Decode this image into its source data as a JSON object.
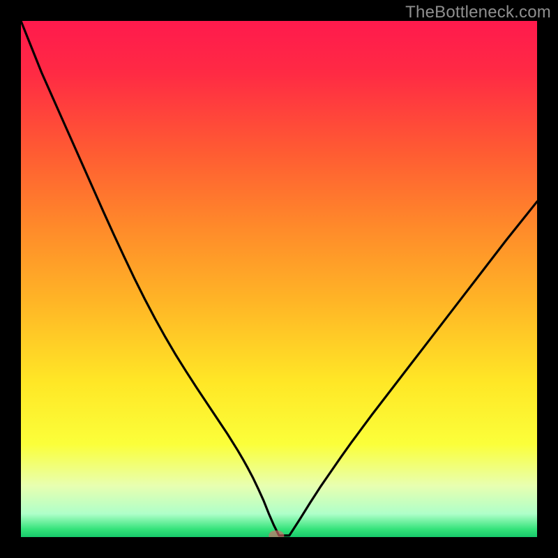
{
  "watermark": "TheBottleneck.com",
  "colors": {
    "frame": "#000000",
    "watermark": "#8f8f8f",
    "curve": "#000000",
    "gradient_stops": [
      {
        "offset": 0.0,
        "color": "#ff1a4d"
      },
      {
        "offset": 0.1,
        "color": "#ff2a44"
      },
      {
        "offset": 0.25,
        "color": "#ff5a33"
      },
      {
        "offset": 0.4,
        "color": "#ff8a2a"
      },
      {
        "offset": 0.55,
        "color": "#ffb726"
      },
      {
        "offset": 0.7,
        "color": "#ffe726"
      },
      {
        "offset": 0.82,
        "color": "#fbff3a"
      },
      {
        "offset": 0.9,
        "color": "#e8ffb0"
      },
      {
        "offset": 0.955,
        "color": "#afffc9"
      },
      {
        "offset": 0.985,
        "color": "#34e37a"
      },
      {
        "offset": 1.0,
        "color": "#17c96b"
      }
    ],
    "marker_fill": "#d86a6a",
    "marker_opacity": 0.65
  },
  "chart_data": {
    "type": "line",
    "title": "",
    "xlabel": "",
    "ylabel": "",
    "xlim": [
      0,
      100
    ],
    "ylim": [
      0,
      100
    ],
    "grid": false,
    "x": [
      0,
      2,
      4,
      6,
      8,
      10,
      12,
      14,
      16,
      18,
      20,
      22,
      24,
      26,
      28,
      30,
      32,
      34,
      36,
      38,
      40,
      42,
      43,
      44,
      45,
      46,
      47,
      48,
      49,
      50,
      52,
      54,
      56,
      58,
      60,
      62,
      64,
      66,
      68,
      70,
      72,
      74,
      76,
      78,
      80,
      82,
      84,
      86,
      88,
      90,
      92,
      94,
      96,
      98,
      100
    ],
    "y": [
      100,
      95,
      90,
      85.5,
      81,
      76.5,
      72,
      67.5,
      63,
      58.6,
      54.3,
      50.1,
      46.1,
      42.3,
      38.7,
      35.3,
      32.1,
      29.0,
      26.0,
      23.0,
      20.0,
      16.8,
      15.1,
      13.3,
      11.4,
      9.3,
      7.1,
      4.6,
      2.3,
      0.3,
      0.3,
      3.4,
      6.6,
      9.7,
      12.6,
      15.5,
      18.3,
      21.0,
      23.7,
      26.3,
      28.9,
      31.5,
      34.1,
      36.7,
      39.3,
      41.9,
      44.5,
      47.1,
      49.7,
      52.3,
      54.9,
      57.5,
      60.0,
      62.5,
      65.0
    ],
    "marker": {
      "x": 49.5,
      "y": 0.3,
      "rx": 1.5,
      "ry": 1.0
    }
  }
}
